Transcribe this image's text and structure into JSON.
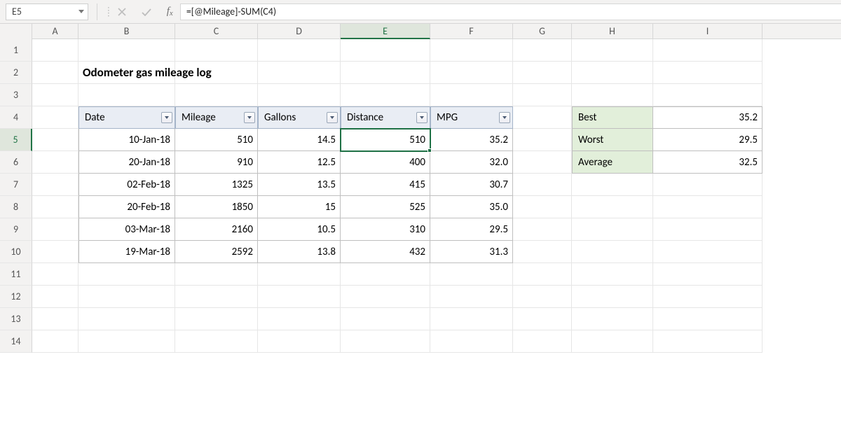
{
  "formula_bar": {
    "cell_ref": "E5",
    "formula": "=[@Mileage]-SUM(C4)"
  },
  "columns": [
    "A",
    "B",
    "C",
    "D",
    "E",
    "F",
    "G",
    "H",
    "I"
  ],
  "selected_col": "E",
  "selected_row": "5",
  "row_numbers": [
    "1",
    "2",
    "3",
    "4",
    "5",
    "6",
    "7",
    "8",
    "9",
    "10",
    "11",
    "12",
    "13",
    "14"
  ],
  "title": "Odometer gas mileage log",
  "table": {
    "headers": [
      "Date",
      "Mileage",
      "Gallons",
      "Distance",
      "MPG"
    ],
    "rows": [
      {
        "date": "10-Jan-18",
        "mileage": "510",
        "gallons": "14.5",
        "distance": "510",
        "mpg": "35.2"
      },
      {
        "date": "20-Jan-18",
        "mileage": "910",
        "gallons": "12.5",
        "distance": "400",
        "mpg": "32.0"
      },
      {
        "date": "02-Feb-18",
        "mileage": "1325",
        "gallons": "13.5",
        "distance": "415",
        "mpg": "30.7"
      },
      {
        "date": "20-Feb-18",
        "mileage": "1850",
        "gallons": "15",
        "distance": "525",
        "mpg": "35.0"
      },
      {
        "date": "03-Mar-18",
        "mileage": "2160",
        "gallons": "10.5",
        "distance": "310",
        "mpg": "29.5"
      },
      {
        "date": "19-Mar-18",
        "mileage": "2592",
        "gallons": "13.8",
        "distance": "432",
        "mpg": "31.3"
      }
    ]
  },
  "summary": [
    {
      "label": "Best",
      "value": "35.2"
    },
    {
      "label": "Worst",
      "value": "29.5"
    },
    {
      "label": "Average",
      "value": "32.5"
    }
  ],
  "chart_data": {
    "type": "table",
    "title": "Odometer gas mileage log",
    "columns": [
      "Date",
      "Mileage",
      "Gallons",
      "Distance",
      "MPG"
    ],
    "rows": [
      [
        "10-Jan-18",
        510,
        14.5,
        510,
        35.2
      ],
      [
        "20-Jan-18",
        910,
        12.5,
        400,
        32.0
      ],
      [
        "02-Feb-18",
        1325,
        13.5,
        415,
        30.7
      ],
      [
        "20-Feb-18",
        1850,
        15,
        525,
        35.0
      ],
      [
        "03-Mar-18",
        2160,
        10.5,
        310,
        29.5
      ],
      [
        "19-Mar-18",
        2592,
        13.8,
        432,
        31.3
      ]
    ],
    "summary": {
      "Best": 35.2,
      "Worst": 29.5,
      "Average": 32.5
    }
  }
}
